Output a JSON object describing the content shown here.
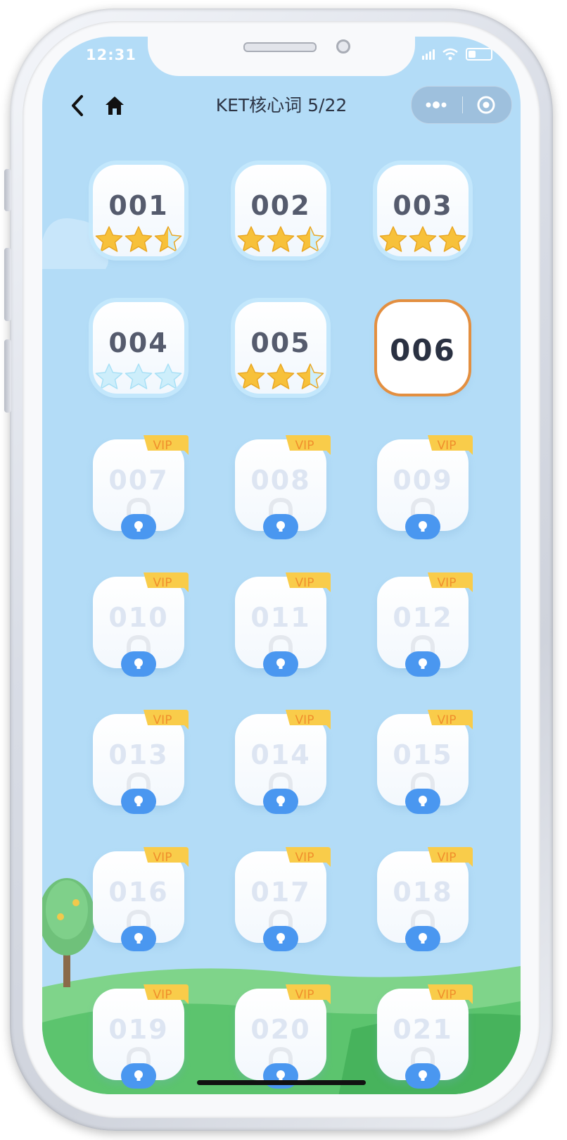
{
  "status_bar": {
    "time": "12:31"
  },
  "nav": {
    "title": "KET核心词 5/22",
    "back_icon": "chevron-left-icon",
    "home_icon": "home-icon",
    "more_icon": "more-dots-icon",
    "close_icon": "target-circle-icon"
  },
  "colors": {
    "screen_bg": "#b3dcf7",
    "current_border": "#e38f40",
    "star_gold": "#f7c13a",
    "star_empty": "#cdeefb",
    "vip_ribbon": "#f9cc4a",
    "vip_text": "#f08f2c",
    "lock_blue": "#4a97f0",
    "hill_green": "#5cc46e"
  },
  "levels": [
    {
      "num": "001",
      "status": "done",
      "stars": 2.5
    },
    {
      "num": "002",
      "status": "done",
      "stars": 2.5
    },
    {
      "num": "003",
      "status": "done",
      "stars": 3
    },
    {
      "num": "004",
      "status": "done",
      "stars": 0
    },
    {
      "num": "005",
      "status": "done",
      "stars": 2.5
    },
    {
      "num": "006",
      "status": "current",
      "stars": 0
    },
    {
      "num": "007",
      "status": "locked",
      "badge": "VIP"
    },
    {
      "num": "008",
      "status": "locked",
      "badge": "VIP"
    },
    {
      "num": "009",
      "status": "locked",
      "badge": "VIP"
    },
    {
      "num": "010",
      "status": "locked",
      "badge": "VIP"
    },
    {
      "num": "011",
      "status": "locked",
      "badge": "VIP"
    },
    {
      "num": "012",
      "status": "locked",
      "badge": "VIP"
    },
    {
      "num": "013",
      "status": "locked",
      "badge": "VIP"
    },
    {
      "num": "014",
      "status": "locked",
      "badge": "VIP"
    },
    {
      "num": "015",
      "status": "locked",
      "badge": "VIP"
    },
    {
      "num": "016",
      "status": "locked",
      "badge": "VIP"
    },
    {
      "num": "017",
      "status": "locked",
      "badge": "VIP"
    },
    {
      "num": "018",
      "status": "locked",
      "badge": "VIP"
    },
    {
      "num": "019",
      "status": "locked",
      "badge": "VIP"
    },
    {
      "num": "020",
      "status": "locked",
      "badge": "VIP"
    },
    {
      "num": "021",
      "status": "locked",
      "badge": "VIP"
    }
  ]
}
